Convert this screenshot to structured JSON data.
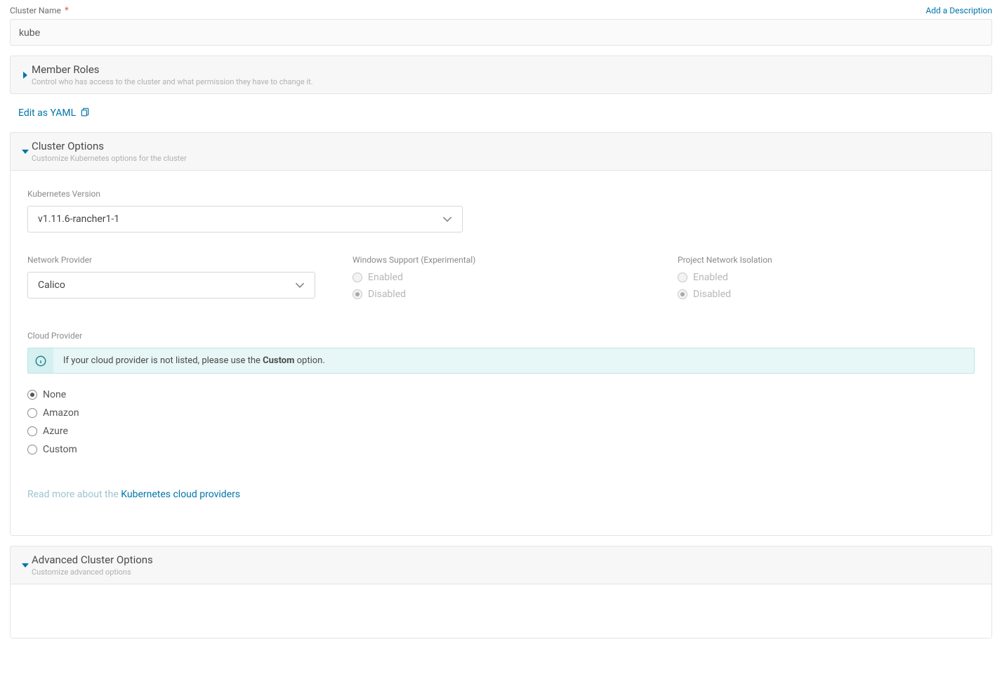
{
  "cluster_name": {
    "label": "Cluster Name",
    "value": "kube"
  },
  "add_description": "Add a Description",
  "member_roles": {
    "title": "Member Roles",
    "sub": "Control who has access to the cluster and what permission they have to change it."
  },
  "edit_yaml": "Edit as YAML",
  "cluster_options": {
    "title": "Cluster Options",
    "sub": "Customize Kubernetes options for the cluster"
  },
  "k8s_version": {
    "label": "Kubernetes Version",
    "value": "v1.11.6-rancher1-1"
  },
  "network_provider": {
    "label": "Network Provider",
    "value": "Calico"
  },
  "windows_support": {
    "label": "Windows Support (Experimental)",
    "enabled_label": "Enabled",
    "disabled_label": "Disabled"
  },
  "project_isolation": {
    "label": "Project Network Isolation",
    "enabled_label": "Enabled",
    "disabled_label": "Disabled"
  },
  "cloud_provider": {
    "label": "Cloud Provider",
    "info_prefix": "If your cloud provider is not listed, please use the ",
    "info_bold": "Custom",
    "info_suffix": " option.",
    "options": [
      "None",
      "Amazon",
      "Azure",
      "Custom"
    ],
    "selected": "None"
  },
  "readmore": {
    "prefix": "Read more about the ",
    "link": "Kubernetes cloud providers"
  },
  "advanced": {
    "title": "Advanced Cluster Options",
    "sub": "Customize advanced options"
  }
}
